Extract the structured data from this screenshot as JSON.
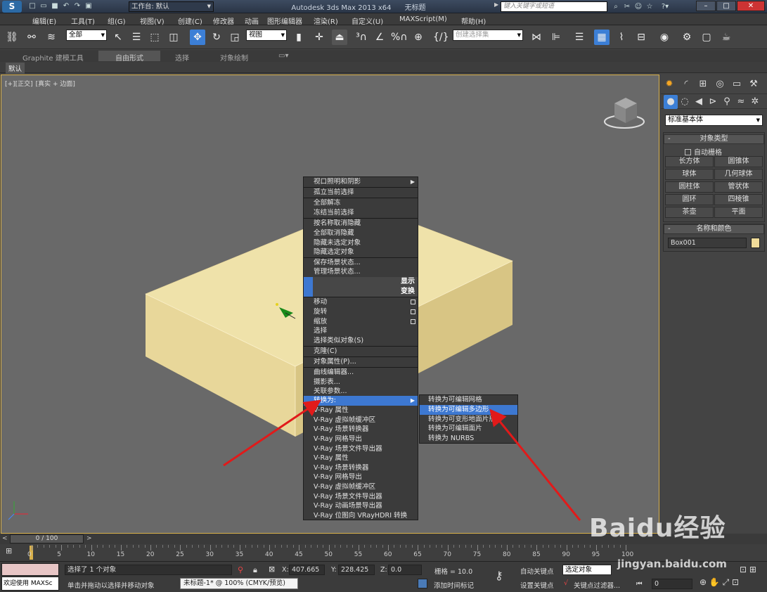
{
  "titlebar": {
    "workspace_label": "工作台: 默认",
    "app_title": "Autodesk 3ds Max  2013 x64",
    "doc_title": "无标题",
    "search_placeholder": "键入关键字或短语"
  },
  "menu": [
    "编辑(E)",
    "工具(T)",
    "组(G)",
    "视图(V)",
    "创建(C)",
    "修改器",
    "动画",
    "图形编辑器",
    "渲染(R)",
    "自定义(U)",
    "MAXScript(M)",
    "帮助(H)"
  ],
  "toolbar": {
    "filter_value": "全部",
    "refcoord_value": "视图",
    "selset_placeholder": "创建选择集"
  },
  "ribbon_tabs": [
    "Graphite 建模工具",
    "自由形式",
    "选择",
    "对象绘制"
  ],
  "default_label": "默认",
  "viewport": {
    "label_plus": "[+]",
    "label_view": "[正交]",
    "label_shade": "[真实 + 边面]"
  },
  "context_menu": {
    "items": [
      {
        "label": "视口照明和阴影",
        "submenu": true
      },
      {
        "label": "孤立当前选择"
      },
      {
        "label": "全部解冻"
      },
      {
        "label": "冻结当前选择"
      },
      {
        "label": "按名称取消隐藏"
      },
      {
        "label": "全部取消隐藏"
      },
      {
        "label": "隐藏未选定对象"
      },
      {
        "label": "隐藏选定对象"
      },
      {
        "label": "保存场景状态..."
      },
      {
        "label": "管理场景状态..."
      }
    ],
    "header_display": "显示",
    "header_transform": "变换",
    "transform_items": [
      "移动",
      "旋转",
      "缩放",
      "选择",
      "选择类似对象(S)"
    ],
    "clone": "克隆(C)",
    "obj_props": "对象属性(P)...",
    "editors": [
      "曲线编辑器...",
      "摄影表...",
      "关联参数..."
    ],
    "convert_to": "转换为:",
    "vray_items": [
      "V-Ray 属性",
      "V-Ray 虚拟帧缓冲区",
      "V-Ray 场景转换器",
      "V-Ray 网格导出",
      "V-Ray 场景文件导出器",
      "V-Ray 属性",
      "V-Ray 场景转换器",
      "V-Ray 网格导出",
      "V-Ray 虚拟帧缓冲区",
      "V-Ray 场景文件导出器",
      "V-Ray 动画场景导出器",
      "V-Ray 位图向 VRayHDRI 转换"
    ]
  },
  "submenu": [
    "转换为可编辑网格",
    "转换为可编辑多边形",
    "转换为可变形地面片形",
    "转换为可编辑面片",
    "转换为 NURBS"
  ],
  "command_panel": {
    "category_value": "标准基本体",
    "rollout_object_type": "对象类型",
    "autogrid": "自动栅格",
    "buttons": [
      "长方体",
      "圆锥体",
      "球体",
      "几何球体",
      "圆柱体",
      "管状体",
      "圆环",
      "四棱锥",
      "茶壶",
      "平面"
    ],
    "rollout_name_color": "名称和颜色",
    "object_name": "Box001",
    "object_color": "#f1dc9a"
  },
  "timeline": {
    "frame_label": "0 / 100",
    "ticks": [
      "0",
      "5",
      "10",
      "15",
      "20",
      "25",
      "30",
      "35",
      "40",
      "45",
      "50",
      "55",
      "60",
      "65",
      "70",
      "75",
      "80",
      "85",
      "90",
      "95",
      "100"
    ]
  },
  "status": {
    "welcome": "欢迎使用 MAXSc",
    "selected": "选择了 1 个对象",
    "hint": "单击并拖动以选择并移动对象",
    "x_label": "X:",
    "x_value": "407.665",
    "y_label": "Y:",
    "y_value": "228.425",
    "z_label": "Z:",
    "z_value": "0.0",
    "grid": "栅格 = 10.0",
    "autokey": "自动关键点",
    "selected_obj": "选定对象",
    "setkey": "设置关键点",
    "keyfilter": "关键点过滤器...",
    "addtime": "添加时间标记",
    "frame_value": "0",
    "tooltip": "未标题-1* @ 100% (CMYK/预览)"
  },
  "watermark": {
    "brand": "Baidu经验",
    "url": "jingyan.baidu.com"
  },
  "colors": {
    "highlight": "#3d78d1",
    "box_top": "#efe2aa",
    "box_front": "#e8d79a",
    "box_side": "#d8c584",
    "arrow": "#e11a1a"
  }
}
